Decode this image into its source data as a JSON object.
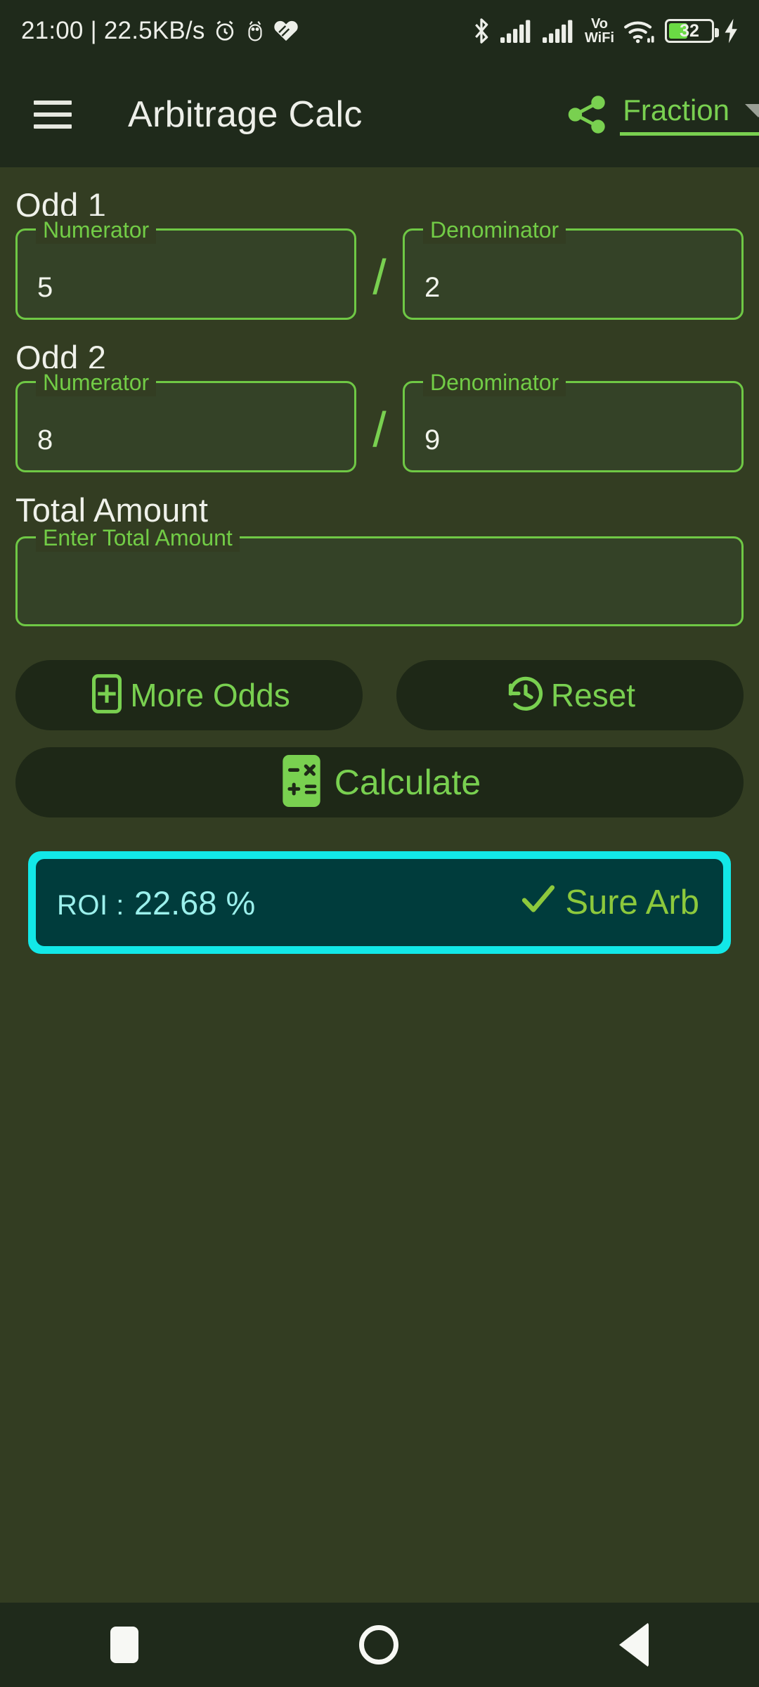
{
  "statusbar": {
    "time": "21:00",
    "separator": "|",
    "network_speed": "22.5KB/s",
    "icons_left": [
      "alarm-icon",
      "android-debug-icon",
      "health-icon"
    ],
    "icons_right": [
      "bluetooth-icon",
      "signal-sim1-icon",
      "signal-sim2-icon",
      "vowifi-icon",
      "wifi-icon"
    ],
    "vowifi_top": "Vo",
    "vowifi_bottom": "WiFi",
    "battery_level": "32",
    "battery_charging": true
  },
  "appbar": {
    "menu_icon": "hamburger-icon",
    "title": "Arbitrage Calc",
    "share_icon": "share-icon",
    "unit_mode": "Fraction",
    "dropdown_icon": "chevron-down-icon"
  },
  "colors": {
    "background": "#333D22",
    "appbar_bg": "#1F2A1B",
    "accent_green": "#79D050",
    "field_border": "#6FC845",
    "field_fill": "#344227",
    "button_bg": "#1E2817",
    "result_border": "#12E8E8",
    "result_fill": "#003C3C",
    "roi_text": "#9BF0EC",
    "sure_arb": "#8DC93C",
    "text_primary": "#EFF1EA"
  },
  "odds": [
    {
      "title": "Odd 1",
      "numerator": {
        "label": "Numerator",
        "value": "5",
        "placeholder": ""
      },
      "separator": "/",
      "denominator": {
        "label": "Denominator",
        "value": "2",
        "placeholder": ""
      }
    },
    {
      "title": "Odd 2",
      "numerator": {
        "label": "Numerator",
        "value": "8",
        "placeholder": ""
      },
      "separator": "/",
      "denominator": {
        "label": "Denominator",
        "value": "9",
        "placeholder": ""
      }
    }
  ],
  "total_amount": {
    "title": "Total Amount",
    "label": "Enter Total Amount",
    "value": "",
    "placeholder": ""
  },
  "actions": {
    "more_odds": {
      "label": "More Odds",
      "icon": "add-box-icon"
    },
    "reset": {
      "label": "Reset",
      "icon": "history-restore-icon"
    },
    "calculate": {
      "label": "Calculate",
      "icon": "calculator-icon"
    }
  },
  "result": {
    "roi_label": "ROI :",
    "roi_value": "22.68 %",
    "status_icon": "check-icon",
    "status_label": "Sure Arb"
  },
  "navbar": {
    "recents": "recents-square-icon",
    "home": "home-circle-icon",
    "back": "back-triangle-icon"
  }
}
